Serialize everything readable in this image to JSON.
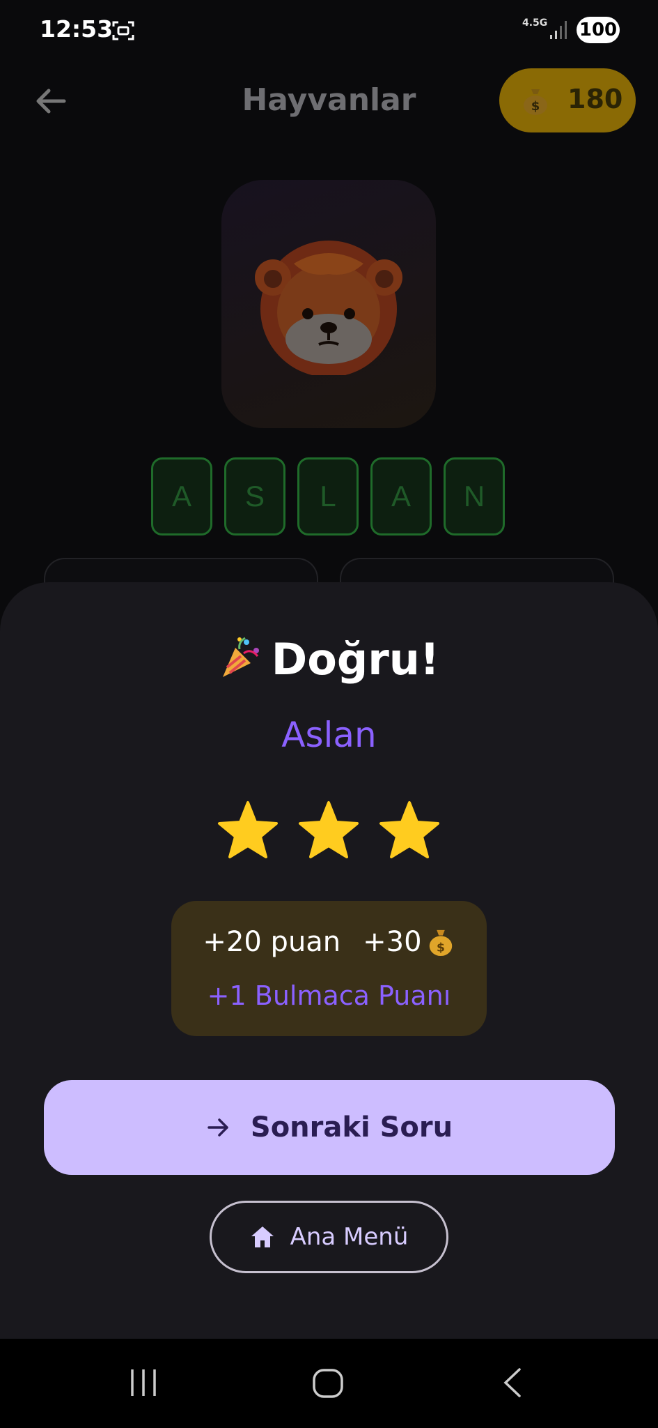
{
  "status_bar": {
    "time": "12:53",
    "network": "4.5G",
    "battery": "100"
  },
  "header": {
    "title": "Hayvanlar",
    "coins": "180"
  },
  "puzzle": {
    "image_icon": "lion-face-emoji",
    "letters": [
      "A",
      "S",
      "L",
      "A",
      "N"
    ]
  },
  "result": {
    "title": "Doğru!",
    "answer": "Aslan",
    "stars_earned": 3,
    "stars_total": 3,
    "reward_points": "+20 puan",
    "reward_coins": "+30",
    "reward_puzzle": "+1 Bulmaca Puanı"
  },
  "actions": {
    "next_label": "Sonraki Soru",
    "menu_label": "Ana Menü"
  },
  "colors": {
    "sheet_bg": "#19181d",
    "accent_purple": "#8b61ff",
    "next_button_bg": "#cdbdff",
    "star": "#ffcc1f",
    "coin_pill": "#8a6a05",
    "letter_border": "#1f6b2a"
  }
}
